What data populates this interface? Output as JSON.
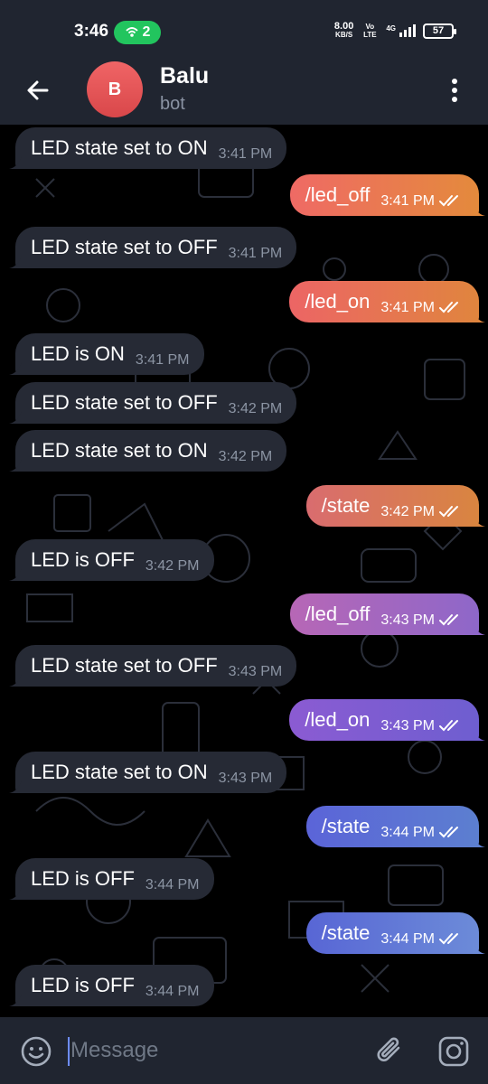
{
  "status_bar": {
    "time": "3:46",
    "hotspot_count": "2",
    "net_speed": "8.00",
    "net_speed_unit": "KB/S",
    "volte": "Vo LTE",
    "network": "4G",
    "battery": "57"
  },
  "header": {
    "back_icon": "back-arrow-icon",
    "avatar_letter": "B",
    "avatar_color": "#e5555a",
    "name": "Balu",
    "subtitle": "bot",
    "menu_icon": "more-vertical-icon"
  },
  "messages": [
    {
      "dir": "in",
      "text": "LED state set to ON",
      "time": "3:41 PM"
    },
    {
      "dir": "out",
      "text": "/led_off",
      "time": "3:41 PM",
      "read": true
    },
    {
      "dir": "in",
      "text": "LED state set to OFF",
      "time": "3:41 PM"
    },
    {
      "dir": "out",
      "text": "/led_on",
      "time": "3:41 PM",
      "read": true
    },
    {
      "dir": "in",
      "text": "LED is ON",
      "time": "3:41 PM"
    },
    {
      "dir": "in",
      "text": "LED state set to OFF",
      "time": "3:42 PM"
    },
    {
      "dir": "in",
      "text": "LED state set to ON",
      "time": "3:42 PM"
    },
    {
      "dir": "out",
      "text": "/state",
      "time": "3:42 PM",
      "read": true
    },
    {
      "dir": "in",
      "text": "LED is OFF",
      "time": "3:42 PM"
    },
    {
      "dir": "out",
      "text": "/led_off",
      "time": "3:43 PM",
      "read": true
    },
    {
      "dir": "in",
      "text": "LED state set to OFF",
      "time": "3:43 PM"
    },
    {
      "dir": "out",
      "text": "/led_on",
      "time": "3:43 PM",
      "read": true
    },
    {
      "dir": "in",
      "text": "LED state set to ON",
      "time": "3:43 PM"
    },
    {
      "dir": "out",
      "text": "/state",
      "time": "3:44 PM",
      "read": true
    },
    {
      "dir": "in",
      "text": "LED is OFF",
      "time": "3:44 PM"
    },
    {
      "dir": "out",
      "text": "/state",
      "time": "3:44 PM",
      "read": true
    },
    {
      "dir": "in",
      "text": "LED is OFF",
      "time": "3:44 PM"
    }
  ],
  "input": {
    "placeholder": "Message",
    "emoji_icon": "emoji-icon",
    "attach_icon": "paperclip-icon",
    "camera_icon": "instagram-camera-icon"
  },
  "colors": {
    "bar_bg": "#202530",
    "incoming_bubble": "#262a35",
    "outgoing_gradient": [
      "#ef6a58",
      "#e08a3c",
      "#b565b9",
      "#7c5bd0",
      "#5c6cd6",
      "#6b8ad8"
    ],
    "chat_bg": "#000000"
  }
}
